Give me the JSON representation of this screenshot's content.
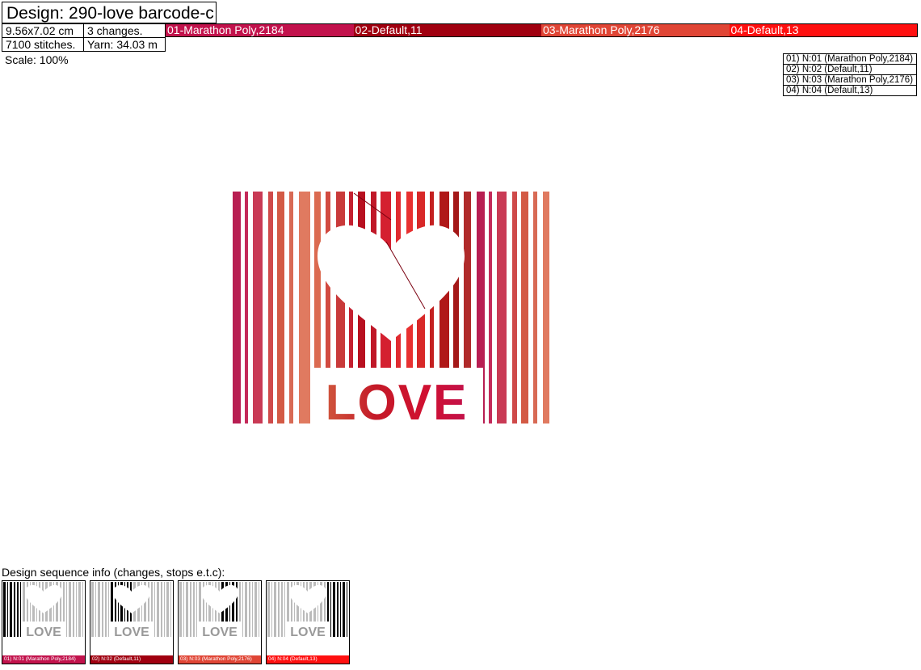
{
  "header": {
    "title": "Design: 290-love barcode-c",
    "size": "9.56x7.02 cm",
    "changes": "3 changes.",
    "stitches": "7100 stitches.",
    "yarn": "Yarn: 34.03 m"
  },
  "color_bar": [
    {
      "label": "01-Marathon Poly,2184",
      "color": "#c2124c"
    },
    {
      "label": "02-Default,11",
      "color": "#a00010"
    },
    {
      "label": "03-Marathon Poly,2176",
      "color": "#e04535"
    },
    {
      "label": "04-Default,13",
      "color": "#ff1010"
    }
  ],
  "scale": "Scale: 100%",
  "legend": [
    "01) N:01 (Marathon Poly,2184)",
    "02) N:02 (Default,11)",
    "03) N:03 (Marathon Poly,2176)",
    "04) N:04 (Default,13)"
  ],
  "design_text": "LOVE",
  "sequence": {
    "label": "Design sequence info (changes, stops e.t.c):",
    "thumbs": [
      {
        "caption": "01) N:01 (Marathon Poly,2184)",
        "color": "#c2124c",
        "active_stop": 1
      },
      {
        "caption": "02) N:02 (Default,11)",
        "color": "#a00010",
        "active_stop": 2
      },
      {
        "caption": "03) N:03 (Marathon Poly,2176)",
        "color": "#e04535",
        "active_stop": 3
      },
      {
        "caption": "04) N:04 (Default,13)",
        "color": "#ff1010",
        "active_stop": 4
      }
    ],
    "thumb_text": "LOVE"
  }
}
